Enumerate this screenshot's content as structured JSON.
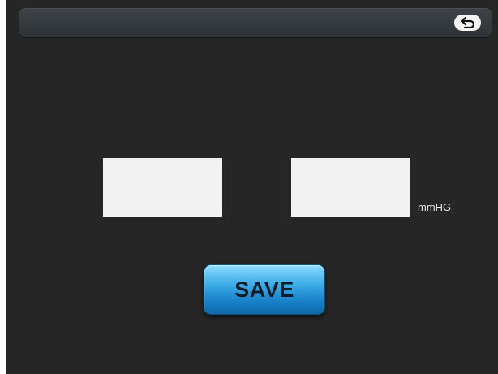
{
  "topbar": {
    "back_icon": "back-arrow-icon"
  },
  "bp_form": {
    "systolic_value": "",
    "diastolic_value": "",
    "unit": "mmHG",
    "save_label": "SAVE"
  },
  "colors": {
    "background": "#262626",
    "topbar": "#363a3e",
    "input_bg": "#f2f2f2",
    "save_button": "#2a9be0"
  }
}
